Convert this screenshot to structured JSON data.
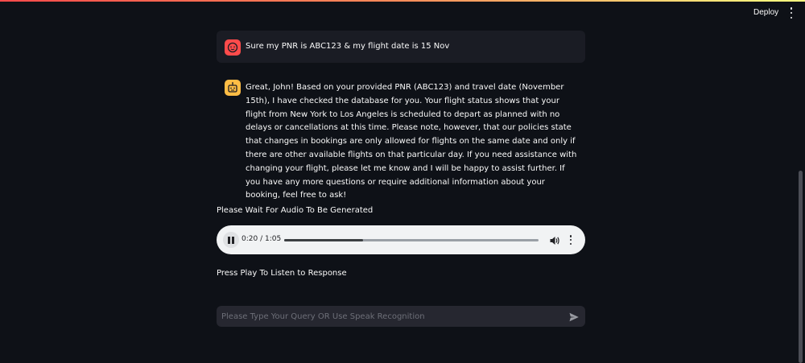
{
  "header": {
    "deploy_label": "Deploy",
    "menu_icon": "kebab-menu-icon"
  },
  "chat": {
    "user_message": "Sure my PNR is ABC123 & my flight date is 15 Nov",
    "user_avatar_icon": "user-face-icon",
    "assistant_avatar_icon": "robot-icon",
    "assistant_message": "Great, John! Based on your provided PNR (ABC123) and travel date (November 15th), I have checked the database for you. Your flight status shows that your flight from New York to Los Angeles is scheduled to depart as planned with no delays or cancellations at this time. Please note, however, that our policies state that changes in bookings are only allowed for flights on the same date and only if there are other available flights on that particular day. If you need assistance with changing your flight, please let me know and I will be happy to assist further. If you have any more questions or require additional information about your booking, feel free to ask!"
  },
  "audio": {
    "wait_label": "Please Wait For Audio To Be Generated",
    "time_display": "0:20 / 1:05",
    "progress_fraction": 0.31,
    "play_state_icon": "pause-icon"
  },
  "press_label": "Press Play To Listen to Response",
  "input": {
    "placeholder": "Please Type Your Query OR Use Speak Recognition",
    "value": "",
    "send_icon": "send-icon"
  },
  "colors": {
    "background": "#0e1117",
    "user_avatar": "#ff4b4b",
    "assistant_avatar": "#ffbd45",
    "bubble": "#1a1c24",
    "input": "#262730"
  }
}
